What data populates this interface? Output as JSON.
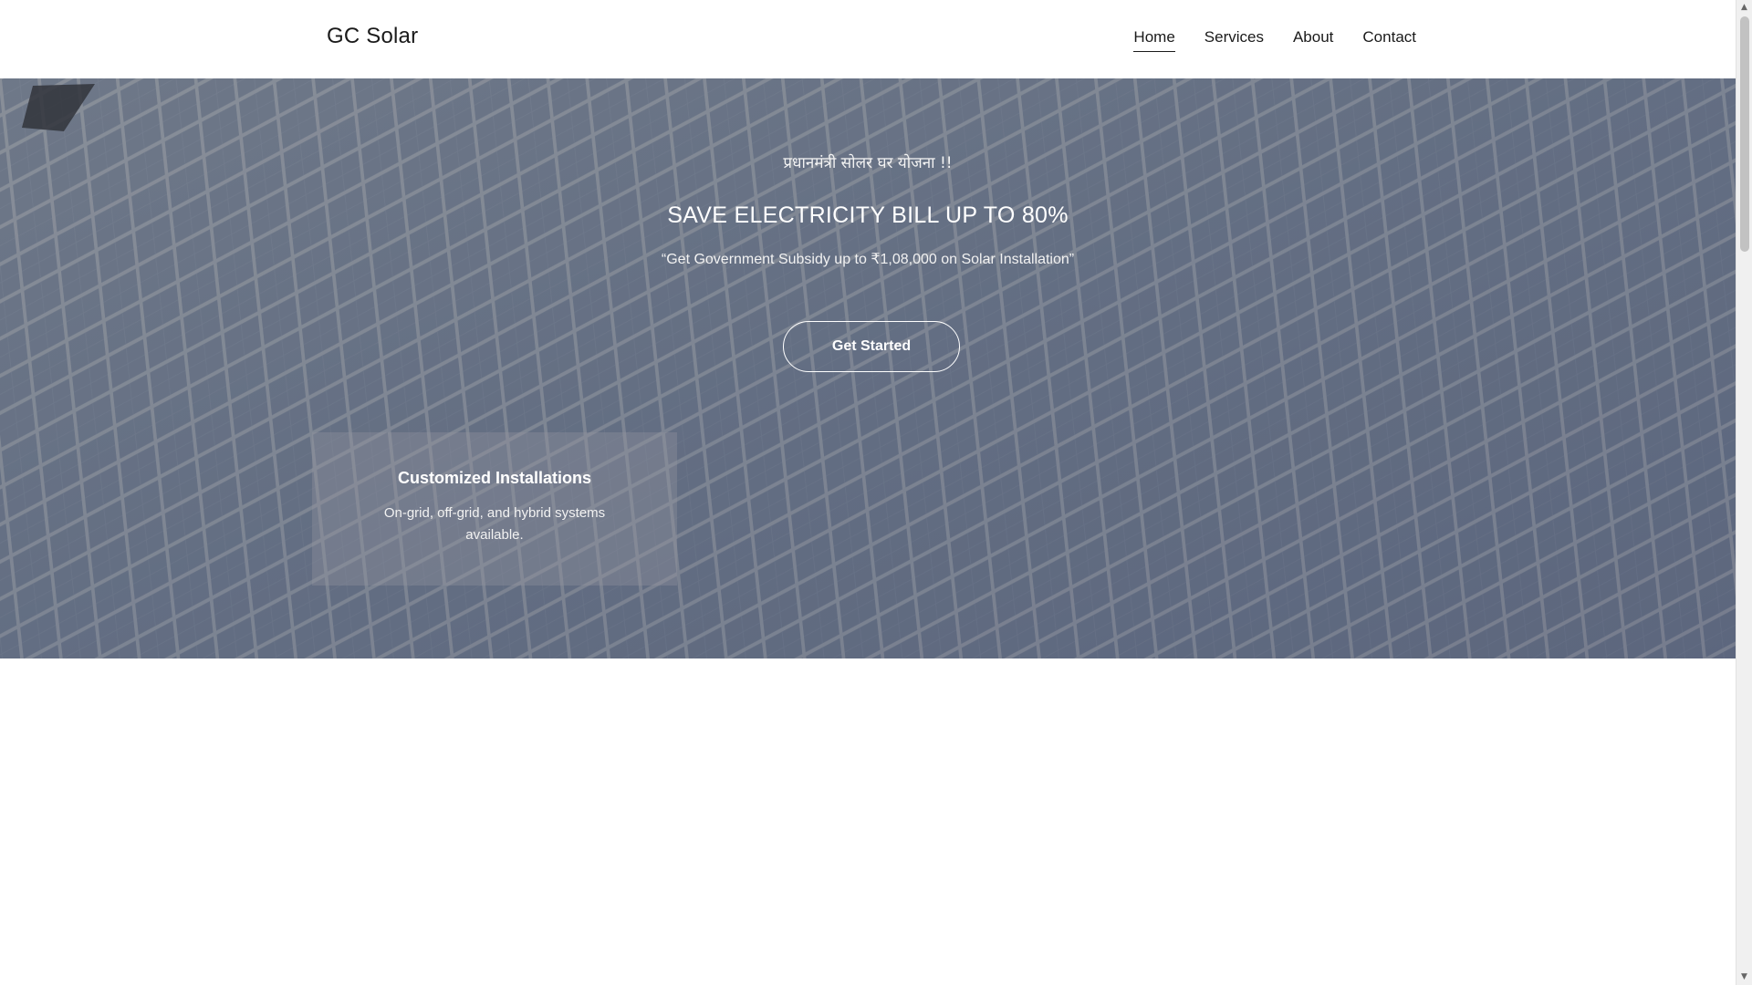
{
  "header": {
    "brand": "GC Solar",
    "nav": [
      {
        "label": "Home",
        "active": true
      },
      {
        "label": "Services",
        "active": false
      },
      {
        "label": "About",
        "active": false
      },
      {
        "label": "Contact",
        "active": false
      }
    ]
  },
  "hero": {
    "kicker": "प्रधानमंत्री सोलर घर योजना !!",
    "title": "SAVE ELECTRICITY BILL UP TO 80%",
    "subtitle": "“Get Government Subsidy up to ₹1,08,000 on Solar Installation”",
    "cta_label": "Get Started",
    "background": "solar-panel-field-photo"
  },
  "feature": {
    "title": "Customized Installations",
    "text": "On-grid, off-grid, and hybrid systems available."
  },
  "scrollbar": {
    "up_icon": "chevron-up-icon",
    "down_icon": "chevron-down-icon"
  },
  "colors": {
    "header_bg": "#ffffff",
    "hero_tint": "#5f6e82",
    "text_dark": "#1a1a1a",
    "text_light": "#ffffff"
  }
}
